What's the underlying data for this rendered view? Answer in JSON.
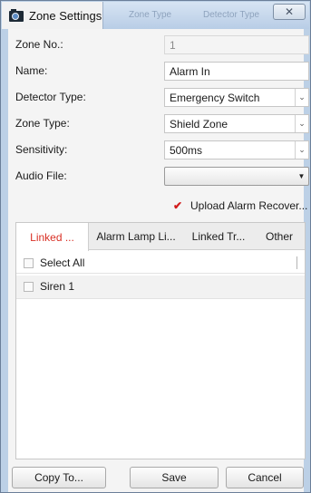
{
  "window": {
    "title": "Zone Settings",
    "ghost_tabs": [
      "Zone Type",
      "Detector Type"
    ],
    "close_glyph": "✕"
  },
  "form": {
    "zone_no": {
      "label": "Zone No.:",
      "value": "1"
    },
    "name": {
      "label": "Name:",
      "value": "Alarm In"
    },
    "detector_type": {
      "label": "Detector Type:",
      "value": "Emergency Switch"
    },
    "zone_type": {
      "label": "Zone Type:",
      "value": "Shield Zone"
    },
    "sensitivity": {
      "label": "Sensitivity:",
      "value": "500ms"
    },
    "audio_file": {
      "label": "Audio File:",
      "value": ""
    },
    "upload_alarm_recovery": {
      "label": "Upload Alarm Recover...",
      "checked": true
    }
  },
  "linkage_tabs": [
    {
      "label": "Linked ...",
      "active": true
    },
    {
      "label": "Alarm Lamp Li...",
      "active": false
    },
    {
      "label": "Linked Tr...",
      "active": false
    },
    {
      "label": "Other",
      "active": false
    }
  ],
  "linked_list": {
    "select_all_label": "Select All",
    "items": [
      {
        "label": "Siren 1",
        "checked": false
      }
    ]
  },
  "buttons": {
    "copy_to": "Copy To...",
    "save": "Save",
    "cancel": "Cancel"
  },
  "colors": {
    "active_tab_text": "#d93025",
    "check_mark": "#d11b1b"
  },
  "icons": {
    "window_icon": "camera-icon",
    "dropdown": "chevron-down-icon",
    "check": "checkmark-icon"
  }
}
